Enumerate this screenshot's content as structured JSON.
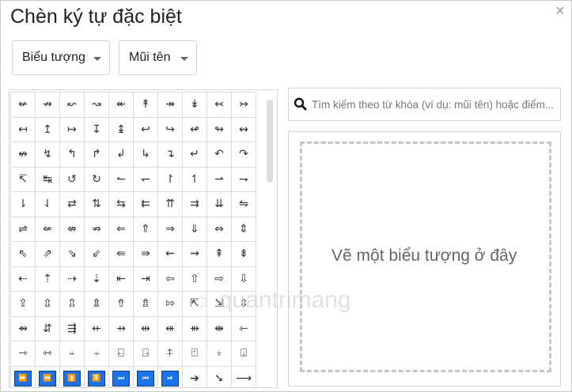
{
  "dialog": {
    "title": "Chèn ký tự đặc biệt",
    "close_icon": "×"
  },
  "filters": {
    "category": "Biểu tượng",
    "subcategory": "Mũi tên"
  },
  "search": {
    "placeholder": "Tìm kiếm theo từ khóa (ví dụ: mũi tên) hoặc điểm..."
  },
  "draw": {
    "hint": "Vẽ một biểu tượng ở đây"
  },
  "accent": "#1a73e8",
  "watermark": "quantrimang",
  "grid": [
    [
      "↚",
      "↛",
      "↜",
      "↝",
      "↞",
      "↟",
      "↠",
      "↡",
      "↢",
      "↣"
    ],
    [
      "↤",
      "↥",
      "↦",
      "↧",
      "↨",
      "↩",
      "↪",
      "↫",
      "↬",
      "↭"
    ],
    [
      "↮",
      "↯",
      "↰",
      "↱",
      "↲",
      "↳",
      "↴",
      "↵",
      "↶",
      "↷"
    ],
    [
      "↸",
      "↹",
      "↺",
      "↻",
      "↼",
      "↽",
      "↾",
      "↿",
      "⇀",
      "⇁"
    ],
    [
      "⇂",
      "⇃",
      "⇄",
      "⇅",
      "⇆",
      "⇇",
      "⇈",
      "⇉",
      "⇊",
      "⇋"
    ],
    [
      "⇌",
      "⇍",
      "⇎",
      "⇏",
      "⇐",
      "⇑",
      "⇒",
      "⇓",
      "⇔",
      "⇕"
    ],
    [
      "⇖",
      "⇗",
      "⇘",
      "⇙",
      "⇚",
      "⇛",
      "⇜",
      "⇝",
      "⇞",
      "⇟"
    ],
    [
      "⇠",
      "⇡",
      "⇢",
      "⇣",
      "⇤",
      "⇥",
      "⇦",
      "⇧",
      "⇨",
      "⇩"
    ],
    [
      "⇪",
      "⇫",
      "⇬",
      "⇭",
      "⇮",
      "⇯",
      "⇰",
      "⇱",
      "⇲",
      "⇳"
    ],
    [
      "⇴",
      "⇵",
      "⇶",
      "⇷",
      "⇸",
      "⇹",
      "⇺",
      "⇻",
      "⇼",
      "⇽"
    ],
    [
      "⇾",
      "⇿",
      "⍅",
      "⍆",
      "⍇",
      "⍈",
      "⍏",
      "⍐",
      "⍖",
      "⍗"
    ],
    [
      "⏩",
      "⏪",
      "⏫",
      "⏬",
      "⏭",
      "⏮",
      "⏯",
      "➔",
      "➘",
      "⟶"
    ]
  ],
  "blue_boxed": [
    "⏩",
    "⏪",
    "⏫",
    "⏬",
    "⏭",
    "⏮",
    "⏯"
  ]
}
